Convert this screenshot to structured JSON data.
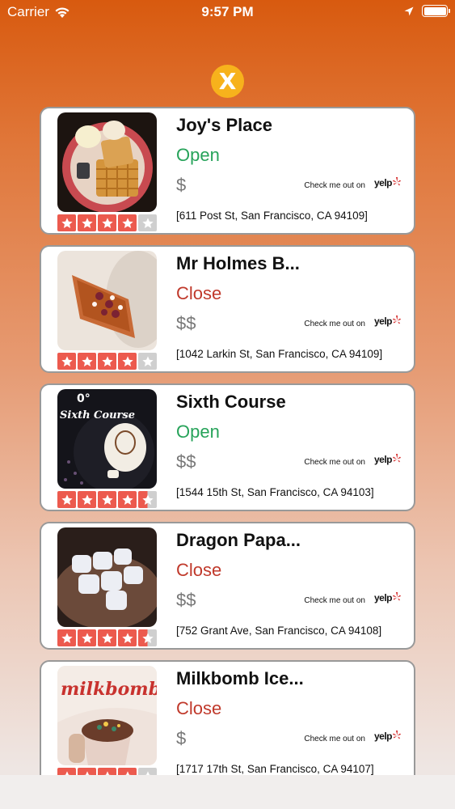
{
  "status_bar": {
    "carrier": "Carrier",
    "time": "9:57 PM"
  },
  "close_button": {
    "label": "X"
  },
  "restaurants": [
    {
      "name": "Joy's Place",
      "status": "Open",
      "price": "$",
      "rating": 4,
      "yelp_cta": "Check me out on",
      "yelp_brand": "yelp",
      "address": "[611 Post St, San Francisco, CA 94109]"
    },
    {
      "name": "Mr Holmes B...",
      "status": "Close",
      "price": "$$",
      "rating": 4,
      "yelp_cta": "Check me out on",
      "yelp_brand": "yelp",
      "address": "[1042 Larkin St, San Francisco, CA 94109]"
    },
    {
      "name": "Sixth Course",
      "status": "Open",
      "price": "$$",
      "rating": 4.5,
      "yelp_cta": "Check me out on",
      "yelp_brand": "yelp",
      "address": "[1544 15th St, San Francisco, CA 94103]"
    },
    {
      "name": "Dragon Papa...",
      "status": "Close",
      "price": "$$",
      "rating": 4.5,
      "yelp_cta": "Check me out on",
      "yelp_brand": "yelp",
      "address": "[752 Grant Ave, San Francisco, CA 94108]"
    },
    {
      "name": "Milkbomb Ice...",
      "status": "Close",
      "price": "$",
      "rating": 4,
      "yelp_cta": "Check me out on",
      "yelp_brand": "yelp",
      "address": "[1717 17th St, San Francisco, CA 94107]"
    }
  ],
  "image_text": {
    "sixth_course": "Sixth Course",
    "milkbomb": "milkbomb"
  },
  "colors": {
    "open": "#27a35a",
    "close": "#c0392b",
    "star": "#ec5a4e",
    "close_button": "#f7b21c"
  }
}
